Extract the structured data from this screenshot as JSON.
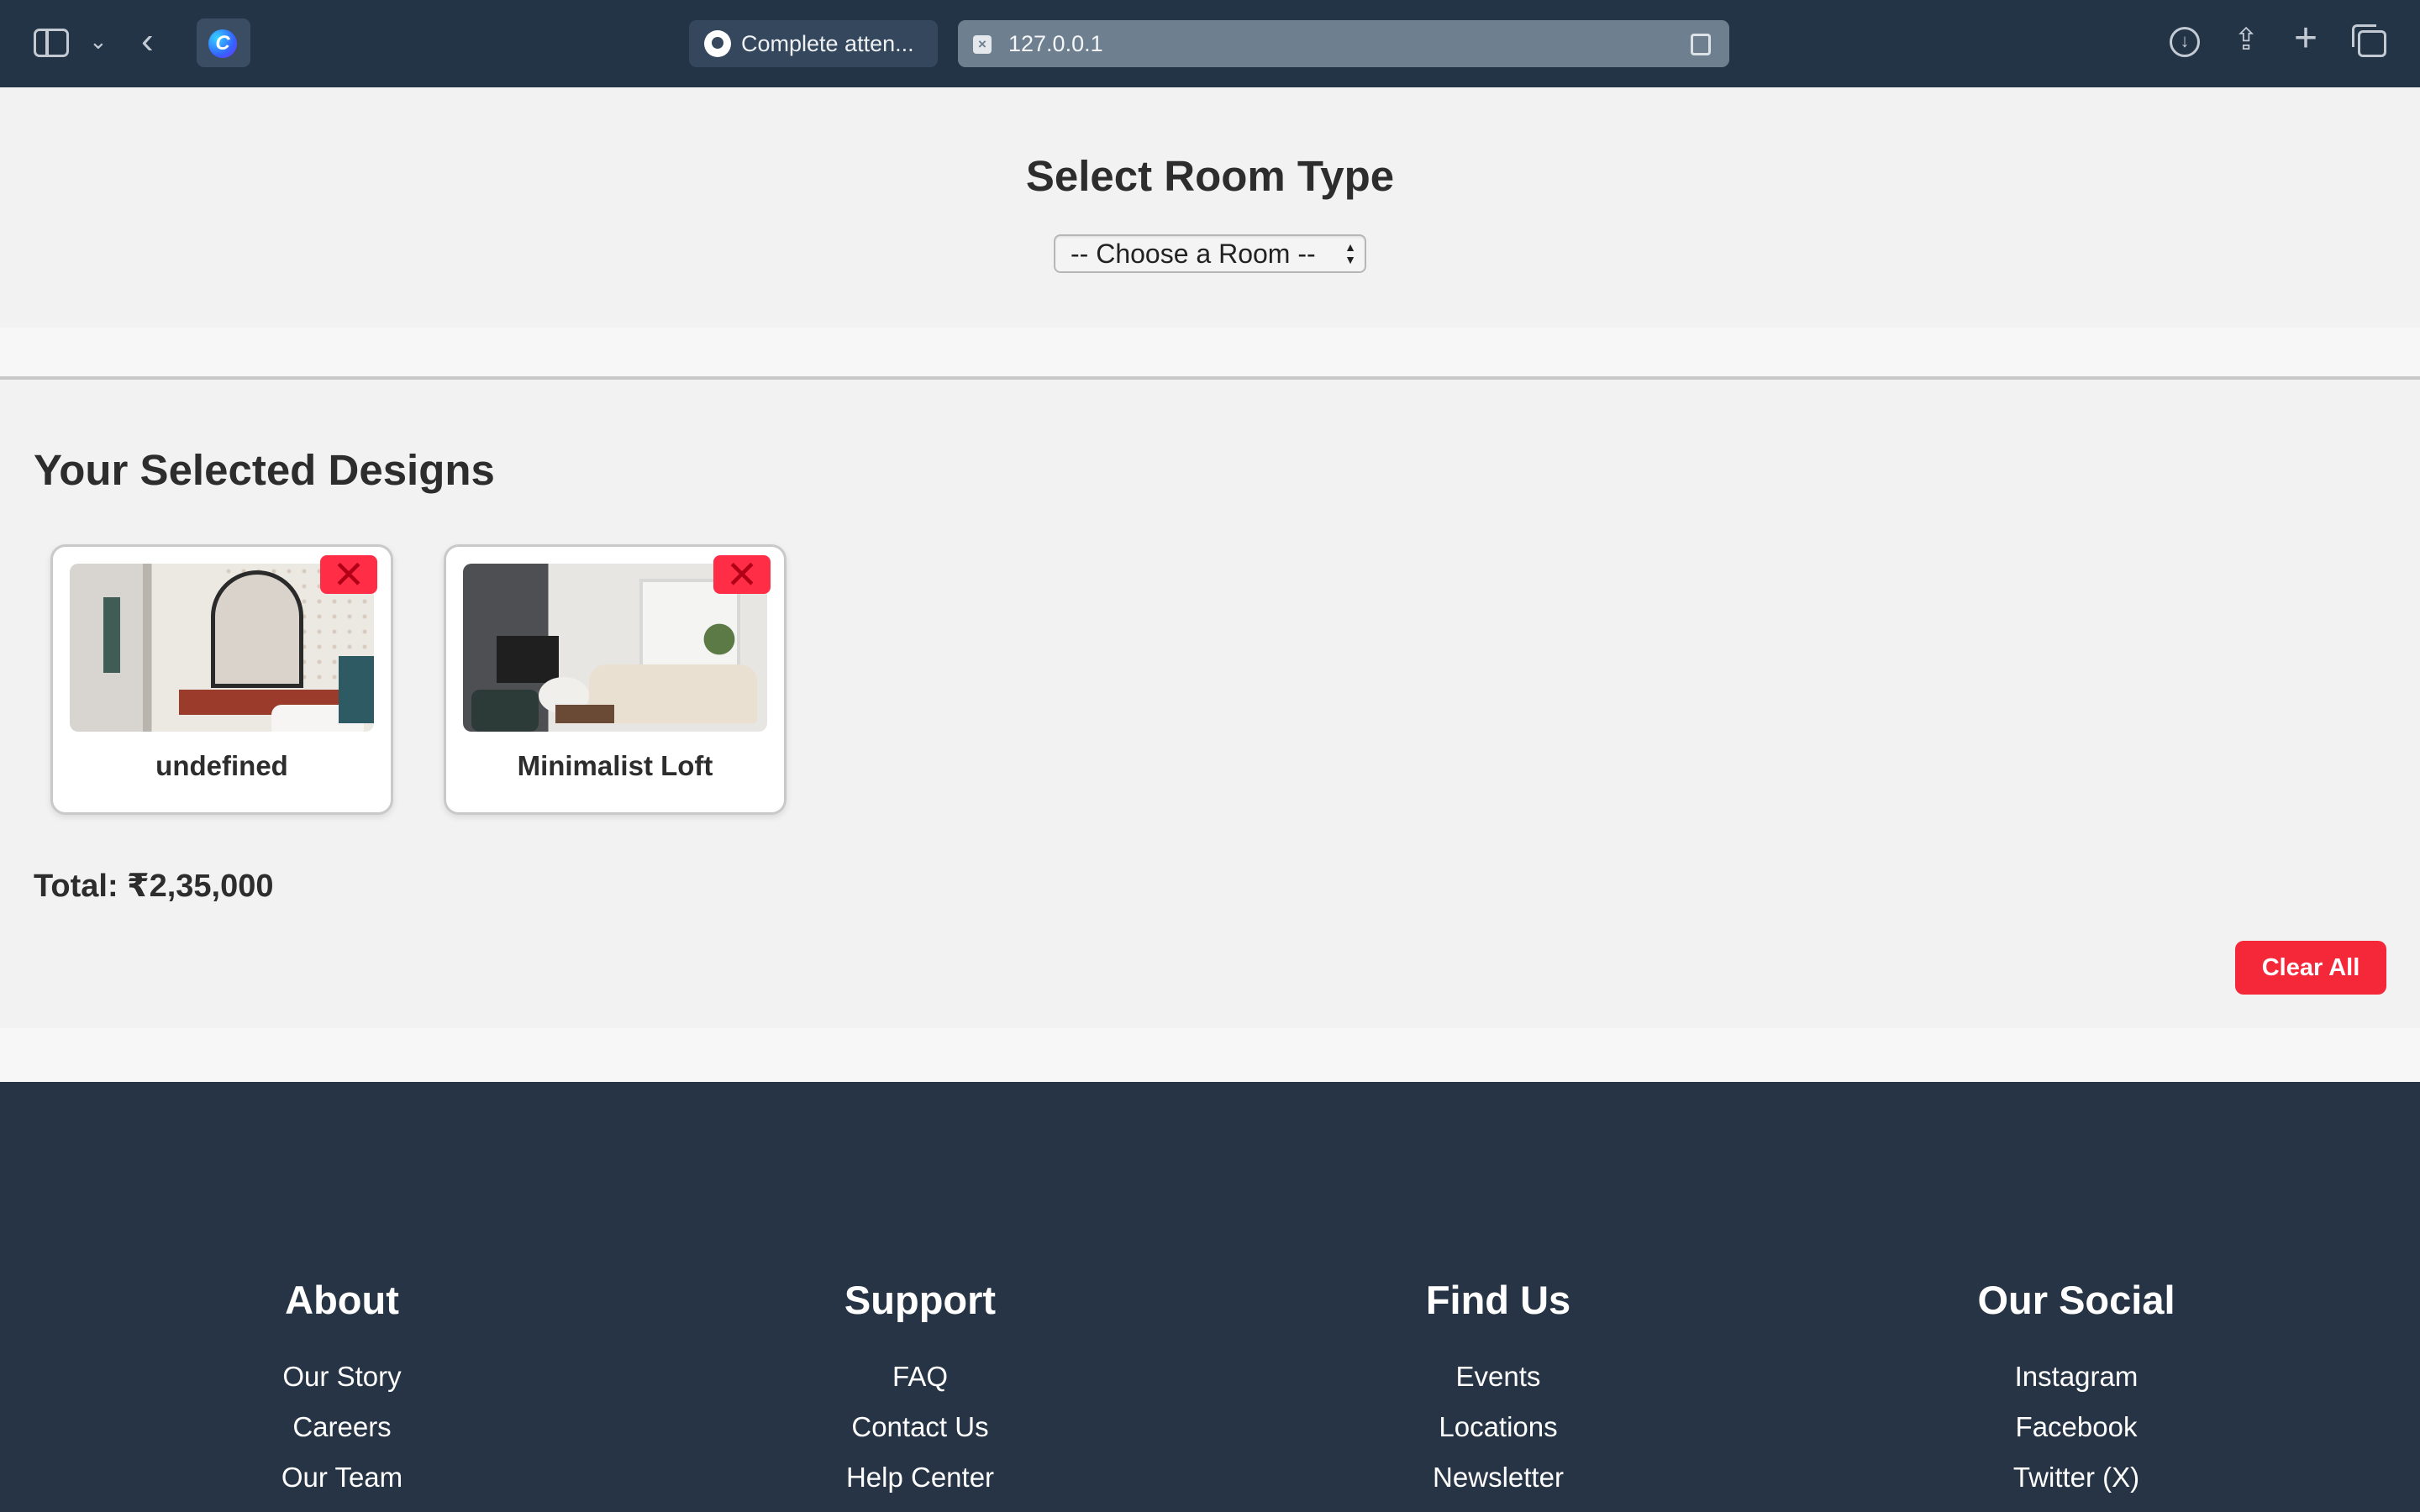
{
  "browser": {
    "tabs": [
      {
        "title": "Complete atten..."
      },
      {
        "title": "127.0.0.1"
      }
    ]
  },
  "room_select": {
    "heading": "Select Room Type",
    "selected": "-- Choose a Room --"
  },
  "selected_designs": {
    "heading": "Your Selected Designs",
    "items": [
      {
        "name": "undefined",
        "remove_label": "✕",
        "image": "bathroom"
      },
      {
        "name": "Minimalist Loft",
        "remove_label": "✕",
        "image": "living-room"
      }
    ],
    "total": "Total: ₹2,35,000",
    "clear_label": "Clear All"
  },
  "footer": {
    "columns": [
      {
        "title": "About",
        "links": [
          "Our Story",
          "Careers",
          "Our Team"
        ]
      },
      {
        "title": "Support",
        "links": [
          "FAQ",
          "Contact Us",
          "Help Center"
        ]
      },
      {
        "title": "Find Us",
        "links": [
          "Events",
          "Locations",
          "Newsletter"
        ]
      },
      {
        "title": "Our Social",
        "links": [
          "Instagram",
          "Facebook",
          "Twitter (X)"
        ]
      }
    ]
  },
  "colors": {
    "chrome": "#233446",
    "footer": "#263445",
    "accent_red": "#f52839",
    "page_bg": "#f2f2f2"
  }
}
